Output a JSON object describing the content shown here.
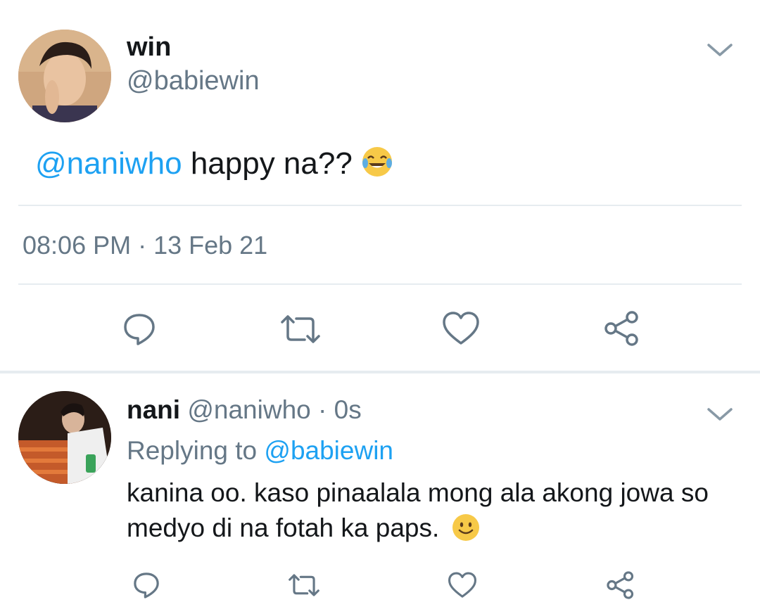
{
  "main_tweet": {
    "display_name": "win",
    "handle": "@babiewin",
    "mention": "@naniwho",
    "text": "happy na??",
    "timestamp": "08:06 PM · 13 Feb 21"
  },
  "reply_tweet": {
    "display_name": "nani",
    "handle": "@naniwho",
    "separator": "·",
    "age": "0s",
    "replying_prefix": "Replying to",
    "replying_handle": "@babiewin",
    "text": "kanina oo. kaso pinaalala mong ala akong jowa so medyo di na fotah ka paps."
  },
  "icons": {
    "menu": "chevron-down-icon",
    "reply": "reply-icon",
    "retweet": "retweet-icon",
    "like": "heart-icon",
    "share": "share-icon",
    "main_emoji": "face-with-tears-of-joy",
    "reply_emoji": "slightly-smiling-face"
  },
  "colors": {
    "link": "#1da1f2",
    "secondary_text": "#657786",
    "divider": "#e6ecf0"
  }
}
